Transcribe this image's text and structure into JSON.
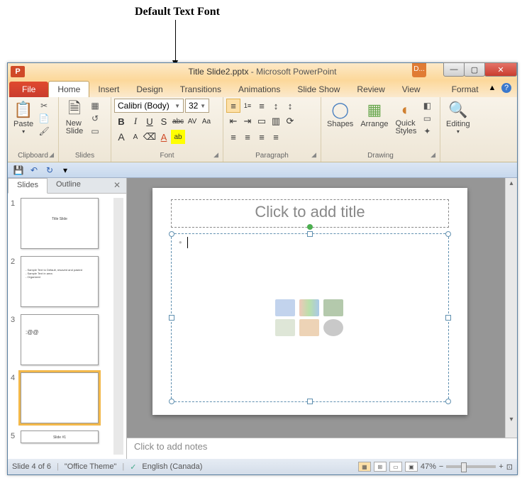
{
  "annotation": "Default Text Font",
  "titlebar": {
    "app_icon_letter": "P",
    "file_name": "Title Slide2.pptx",
    "separator": " - ",
    "app_name": "Microsoft PowerPoint",
    "d_label": "D..."
  },
  "window_buttons": {
    "minimize": "—",
    "maximize": "▢",
    "close": "✕"
  },
  "tabs": {
    "file": "File",
    "items": [
      "Home",
      "Insert",
      "Design",
      "Transitions",
      "Animations",
      "Slide Show",
      "Review",
      "View"
    ],
    "format": "Format",
    "active_index": 0,
    "minimize_ribbon": "▲",
    "help": "?"
  },
  "ribbon": {
    "clipboard": {
      "label": "Clipboard",
      "paste": "Paste",
      "cut_icon": "✂",
      "copy_icon": "📄",
      "format_painter_icon": "🖌"
    },
    "slides": {
      "label": "Slides",
      "new_slide": "New\nSlide",
      "layout_icon": "▦",
      "reset_icon": "↺",
      "section_icon": "▭"
    },
    "font": {
      "label": "Font",
      "name": "Calibri (Body)",
      "size": "32",
      "bold": "B",
      "italic": "I",
      "underline": "U",
      "strike": "abc",
      "shadow": "S",
      "spacing": "AV",
      "case": "Aa",
      "grow": "A",
      "shrink": "A",
      "clear": "⌫",
      "color": "A",
      "highlight": "ab"
    },
    "paragraph": {
      "label": "Paragraph",
      "bullets": "≡",
      "numbering": "1≡",
      "list_level": "≡",
      "dec_indent": "⇤",
      "inc_indent": "⇥",
      "line_spacing": "↕",
      "text_direction": "↕",
      "align_l": "≡",
      "align_c": "≡",
      "align_r": "≡",
      "justify": "≡",
      "columns": "▥",
      "align_text": "▭",
      "smartart": "⟳"
    },
    "drawing": {
      "label": "Drawing",
      "shapes": "Shapes",
      "arrange": "Arrange",
      "quick_styles": "Quick\nStyles",
      "fill_icon": "◧",
      "outline_icon": "▭",
      "effects_icon": "✦"
    },
    "editing": {
      "label": "Editing",
      "find_icon": "🔍",
      "editing": "Editing"
    }
  },
  "qat": {
    "save": "💾",
    "undo": "↶",
    "redo": "↻",
    "more": "▾"
  },
  "side_panel": {
    "tabs": {
      "slides": "Slides",
      "outline": "Outline"
    },
    "close": "✕",
    "thumbs": [
      {
        "n": "1",
        "text": "Title Slide"
      },
      {
        "n": "2",
        "text": "- Sample Text to Default, resaved and pasted\n- Sample Text in area\n- Organized"
      },
      {
        "n": "3",
        "text": ":@@"
      },
      {
        "n": "4",
        "text": ""
      },
      {
        "n": "5",
        "text": "Slide #1"
      }
    ],
    "selected": 3
  },
  "slide": {
    "title_placeholder": "Click to add title"
  },
  "notes": {
    "placeholder": "Click to add notes"
  },
  "statusbar": {
    "slide_pos": "Slide 4 of 6",
    "theme": "\"Office Theme\"",
    "lang": "English (Canada)",
    "zoom": "47%",
    "minus": "−",
    "plus": "+",
    "fit": "⊡"
  }
}
